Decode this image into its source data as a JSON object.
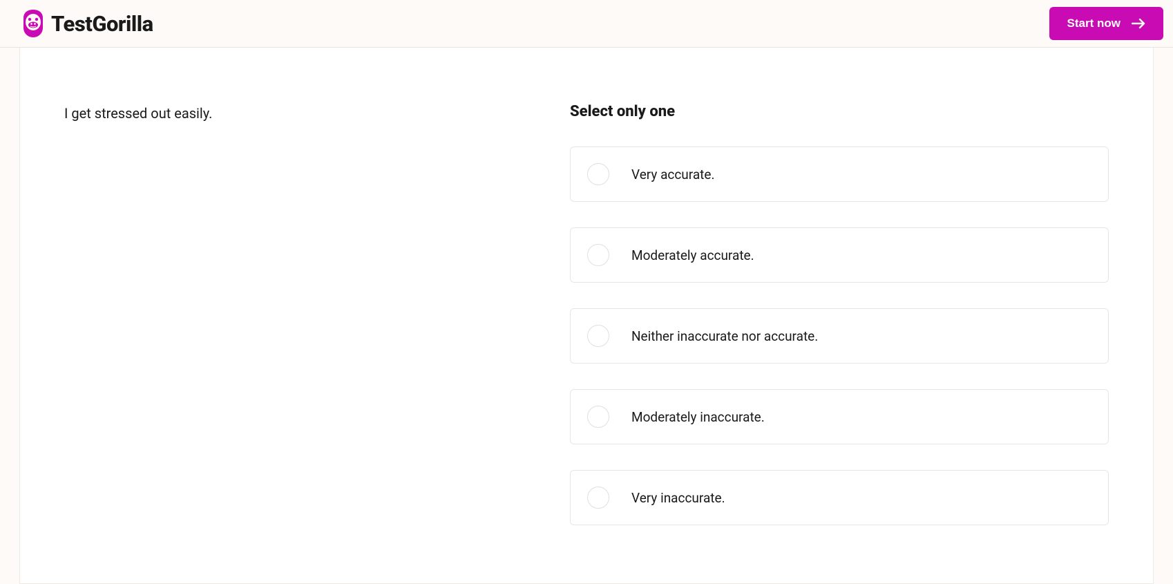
{
  "header": {
    "brand_name": "TestGorilla",
    "cta_label": "Start now"
  },
  "question": {
    "prompt": "I get stressed out easily.",
    "instruction": "Select only one",
    "options": [
      {
        "label": "Very accurate."
      },
      {
        "label": "Moderately accurate."
      },
      {
        "label": "Neither inaccurate nor accurate."
      },
      {
        "label": "Moderately inaccurate."
      },
      {
        "label": "Very inaccurate."
      }
    ]
  },
  "colors": {
    "brand": "#c90bb3"
  }
}
